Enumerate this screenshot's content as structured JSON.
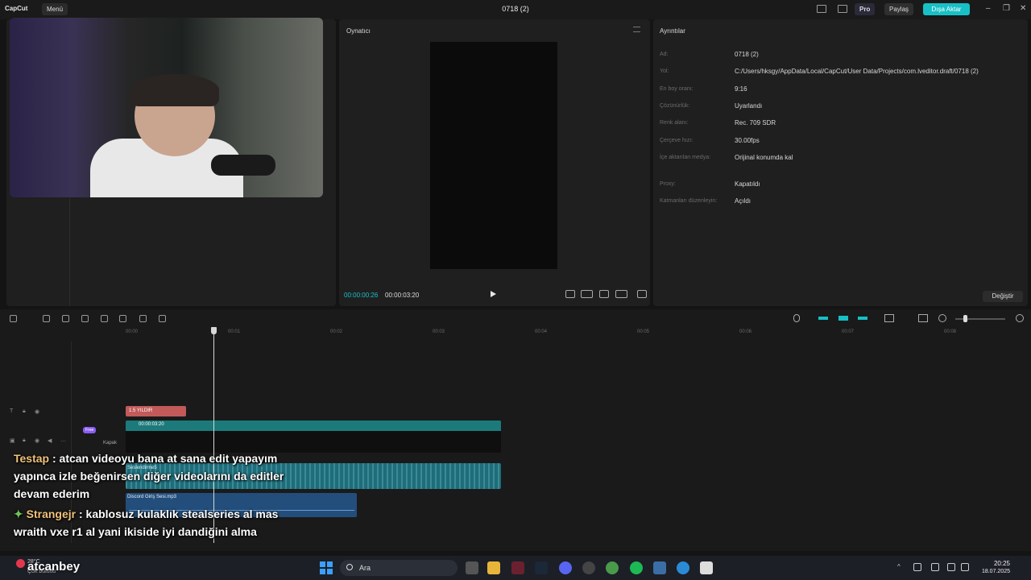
{
  "titlebar": {
    "logo": "CapCut",
    "menu_label": "Menü",
    "project_title": "0718 (2)",
    "pro_label": "Pro",
    "share_label": "Paylaş",
    "export_label": "Dışa Aktar"
  },
  "webcam": {},
  "player": {
    "title": "Oynatıcı",
    "current_time": "00:00:00:26",
    "total_time": "00:00:03:20"
  },
  "details": {
    "title": "Ayrıntılar",
    "rows": [
      {
        "label": "Ad:",
        "value": "0718 (2)"
      },
      {
        "label": "Yol:",
        "value": "C:/Users/hksgy/AppData/Local/CapCut/User Data/Projects/com.lveditor.draft/0718 (2)"
      },
      {
        "label": "En boy oranı:",
        "value": "9:16"
      },
      {
        "label": "Çözünürlük:",
        "value": "Uyarlandı"
      },
      {
        "label": "Renk alanı:",
        "value": "Rec. 709 SDR"
      },
      {
        "label": "Çerçeve hızı:",
        "value": "30.00fps"
      },
      {
        "label": "İçe aktarılan medya:",
        "value": "Orijinal konumda kal"
      },
      {
        "label": "Proxy:",
        "value": "Kapatıldı"
      },
      {
        "label": "Katmanları düzenleyin:",
        "value": "Açıldı"
      }
    ],
    "change_label": "Değiştir"
  },
  "timeline": {
    "ruler_ticks": [
      "00:00",
      "00:01",
      "00:02",
      "00:03",
      "00:04",
      "00:05",
      "00:06",
      "00:07",
      "00:08"
    ],
    "text_clip": "1.5 YILDIR",
    "video_clip_time": "00:00:03:20",
    "audio_clip": "Seslendirme5",
    "discord_clip": "Discord Giriş Sesi.mp3",
    "free_badge": "Free",
    "cover_label": "Kapak"
  },
  "chat": [
    {
      "user": "Testap",
      "line1": " : atcan videoyu bana at sana edit yapayım",
      "line2": "yapınca izle beğenirsen diğer videolarını da editler",
      "line3": "devam ederim"
    },
    {
      "user": "Strangejr",
      "line1": " : kablosuz kulaklık stealseries al mas",
      "line2": "wraith vxe r1 al yani ikiside iyi dandiğini alma"
    }
  ],
  "taskbar": {
    "streamer": "atcanbey",
    "weather_temp": "28°C",
    "weather_desc": "Çok bulutlu",
    "search_label": "Ara",
    "time": "20:25",
    "date": "18.07.2025"
  },
  "colors": {
    "accent": "#18c0c6",
    "text_clip": "#c25a5a",
    "audio_clip": "#1d6d7a",
    "discord_clip": "#234e7b"
  }
}
